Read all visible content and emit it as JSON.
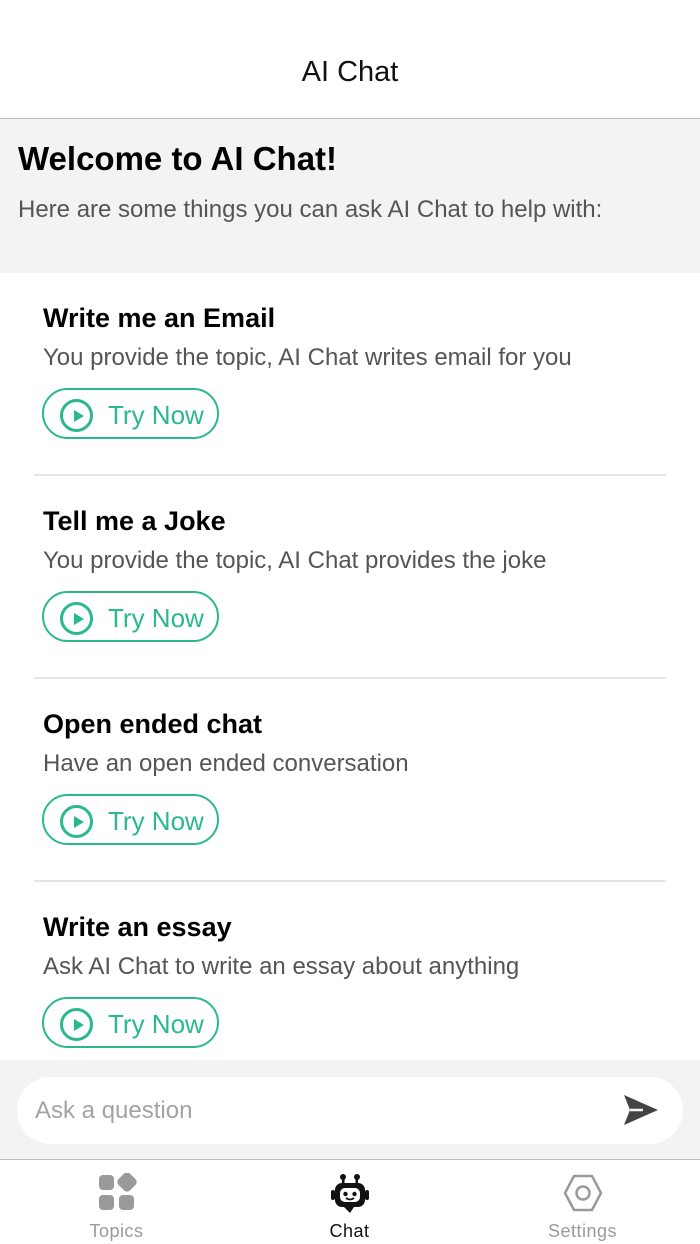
{
  "header": {
    "title": "AI Chat"
  },
  "welcome": {
    "title": "Welcome to AI Chat!",
    "subtitle": "Here are some things you can ask AI Chat to help with:"
  },
  "cards": [
    {
      "title": "Write me an Email",
      "description": "You provide the topic, AI Chat writes email for you",
      "button_label": "Try Now"
    },
    {
      "title": "Tell me a Joke",
      "description": "You provide the topic, AI Chat provides the joke",
      "button_label": "Try Now"
    },
    {
      "title": "Open ended chat",
      "description": "Have an open ended conversation",
      "button_label": "Try Now"
    },
    {
      "title": "Write an essay",
      "description": "Ask AI Chat to write an essay about anything",
      "button_label": "Try Now"
    }
  ],
  "composer": {
    "placeholder": "Ask a question",
    "value": "",
    "send_icon": "send-icon"
  },
  "tabs": [
    {
      "label": "Topics",
      "icon": "grid-icon",
      "active": false
    },
    {
      "label": "Chat",
      "icon": "robot-icon",
      "active": true
    },
    {
      "label": "Settings",
      "icon": "hexagon-gear-icon",
      "active": false
    }
  ],
  "colors": {
    "accent": "#2bb88f",
    "banner_bg": "#f3f3f3",
    "inactive_tab": "#9a9a9a"
  }
}
